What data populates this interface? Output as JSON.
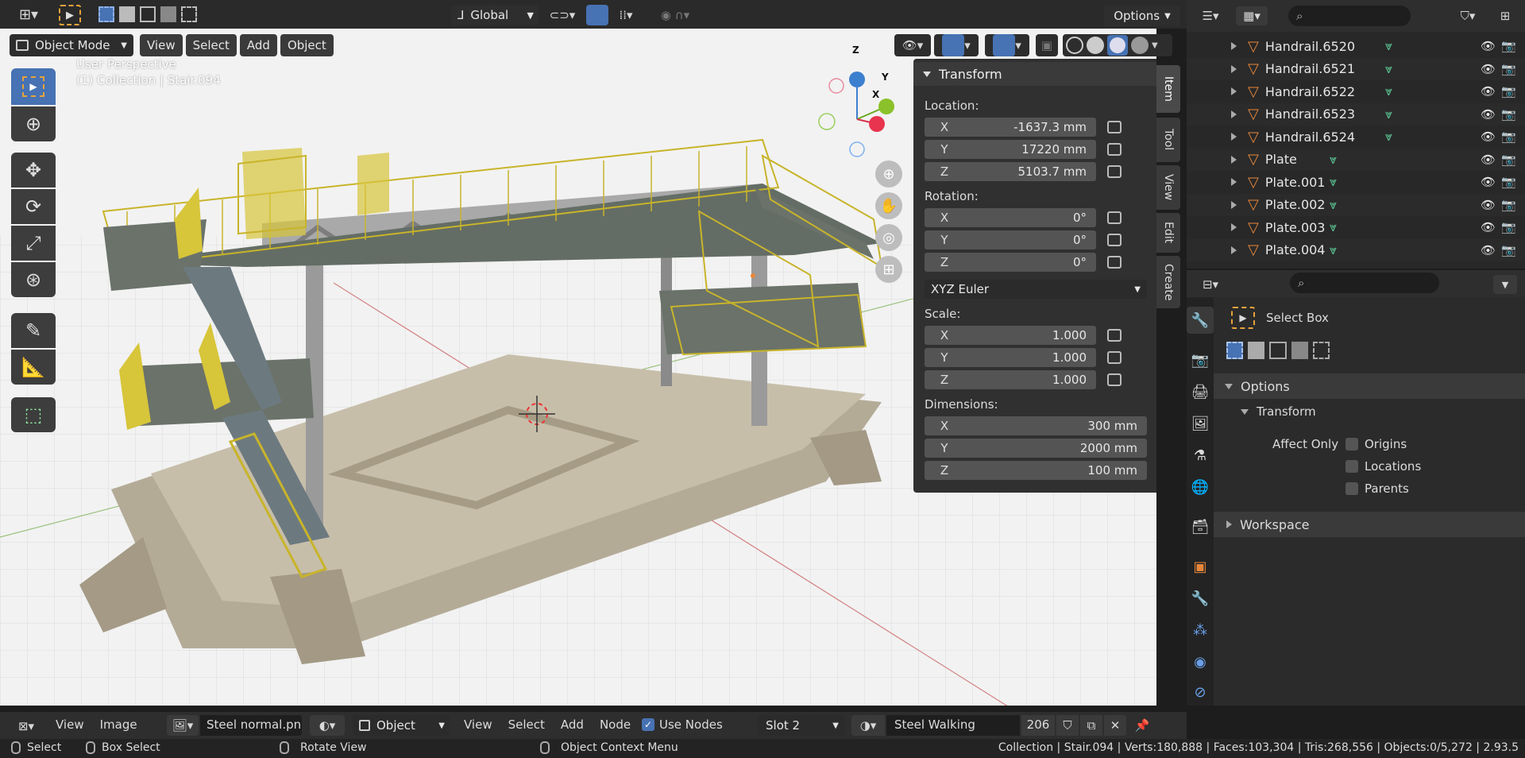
{
  "topbar": {
    "orientation": "Global",
    "options_label": "Options"
  },
  "header": {
    "mode": "Object Mode",
    "menu": [
      "View",
      "Select",
      "Add",
      "Object"
    ]
  },
  "viewport": {
    "perspective_label": "User Perspective",
    "collection_label": "(1) Collection | Stair.094",
    "gizmo": {
      "x": "X",
      "y": "Y",
      "z": "Z"
    }
  },
  "npanel": {
    "title": "Transform",
    "location_label": "Location:",
    "location": [
      {
        "axis": "X",
        "value": "-1637.3 mm"
      },
      {
        "axis": "Y",
        "value": "17220 mm"
      },
      {
        "axis": "Z",
        "value": "5103.7 mm"
      }
    ],
    "rotation_label": "Rotation:",
    "rotation": [
      {
        "axis": "X",
        "value": "0°"
      },
      {
        "axis": "Y",
        "value": "0°"
      },
      {
        "axis": "Z",
        "value": "0°"
      }
    ],
    "rotation_mode": "XYZ Euler",
    "scale_label": "Scale:",
    "scale": [
      {
        "axis": "X",
        "value": "1.000"
      },
      {
        "axis": "Y",
        "value": "1.000"
      },
      {
        "axis": "Z",
        "value": "1.000"
      }
    ],
    "dimensions_label": "Dimensions:",
    "dimensions": [
      {
        "axis": "X",
        "value": "300 mm"
      },
      {
        "axis": "Y",
        "value": "2000 mm"
      },
      {
        "axis": "Z",
        "value": "100 mm"
      }
    ],
    "tabs": [
      "Item",
      "Tool",
      "View",
      "Edit",
      "Create"
    ]
  },
  "outliner": {
    "rows": [
      "Handrail.6520",
      "Handrail.6521",
      "Handrail.6522",
      "Handrail.6523",
      "Handrail.6524",
      "Plate",
      "Plate.001",
      "Plate.002",
      "Plate.003",
      "Plate.004"
    ]
  },
  "properties": {
    "tool_name": "Select Box",
    "options_label": "Options",
    "transform_label": "Transform",
    "affect_only_label": "Affect Only",
    "checkboxes": [
      "Origins",
      "Locations",
      "Parents"
    ],
    "workspace_label": "Workspace"
  },
  "shader_header": {
    "menu1": [
      "View",
      "Image"
    ],
    "image_name": "Steel normal.png",
    "object_label": "Object",
    "menu2": [
      "View",
      "Select",
      "Add",
      "Node"
    ],
    "use_nodes": "Use Nodes",
    "slot": "Slot 2",
    "material": "Steel Walking",
    "users": "206"
  },
  "statusbar": {
    "select": "Select",
    "box_select": "Box Select",
    "rotate_view": "Rotate View",
    "context_menu": "Object Context Menu",
    "stats": "Collection | Stair.094 | Verts:180,888 | Faces:103,304 | Tris:268,556 | Objects:0/5,272 | 2.93.5"
  },
  "colors": {
    "accent": "#4772b3",
    "mesh_orange": "#e8873a",
    "mesh_data_green": "#5fd39c",
    "active_tool": "#4772b3"
  }
}
